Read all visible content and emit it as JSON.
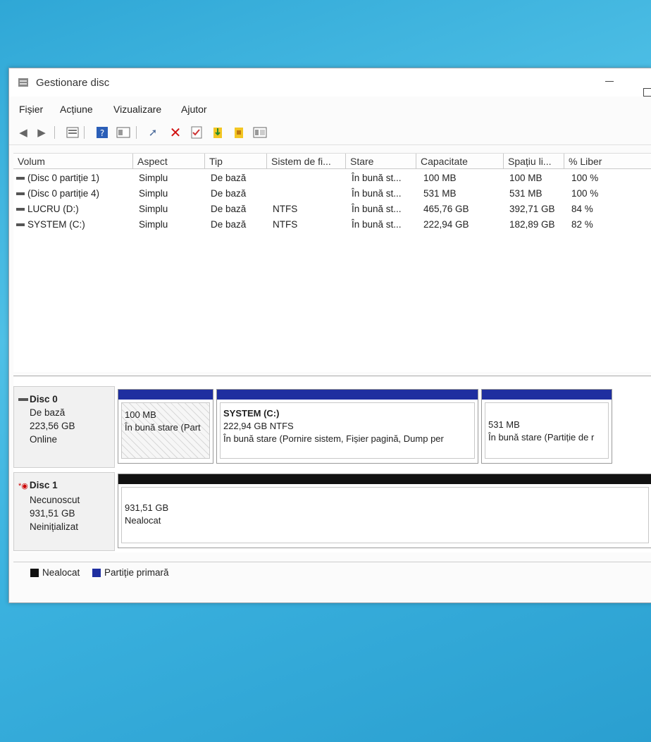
{
  "window": {
    "title": "Gestionare disc"
  },
  "menu": [
    "Fișier",
    "Acțiune",
    "Vizualizare",
    "Ajutor"
  ],
  "toolbar_icons": [
    "back-icon",
    "forward-icon",
    "properties-icon",
    "help-icon",
    "view-icon",
    "connect-icon",
    "delete-icon",
    "check-icon",
    "import-icon",
    "refresh-icon",
    "settings-icon"
  ],
  "columns": [
    "Volum",
    "Aspect",
    "Tip",
    "Sistem de fi...",
    "Stare",
    "Capacitate",
    "Spațiu li...",
    "% Liber"
  ],
  "volumes": [
    {
      "name": "(Disc 0 partiție 1)",
      "aspect": "Simplu",
      "tip": "De bază",
      "fs": "",
      "stare": "În bună st...",
      "capacitate": "100 MB",
      "liber": "100 MB",
      "pct": "100 %"
    },
    {
      "name": "(Disc 0 partiție 4)",
      "aspect": "Simplu",
      "tip": "De bază",
      "fs": "",
      "stare": "În bună st...",
      "capacitate": "531 MB",
      "liber": "531 MB",
      "pct": "100 %"
    },
    {
      "name": "LUCRU (D:)",
      "aspect": "Simplu",
      "tip": "De bază",
      "fs": "NTFS",
      "stare": "În bună st...",
      "capacitate": "465,76 GB",
      "liber": "392,71 GB",
      "pct": "84 %"
    },
    {
      "name": "SYSTEM (C:)",
      "aspect": "Simplu",
      "tip": "De bază",
      "fs": "NTFS",
      "stare": "În bună st...",
      "capacitate": "222,94 GB",
      "liber": "182,89 GB",
      "pct": "82 %"
    }
  ],
  "disk0": {
    "title": "Disc 0",
    "type": "De bază",
    "size": "223,56 GB",
    "status": "Online",
    "partitions": [
      {
        "title": "",
        "line1": "100 MB",
        "line2": "În bună stare (Part"
      },
      {
        "title": "SYSTEM  (C:)",
        "line1": "222,94 GB NTFS",
        "line2": "În bună stare (Pornire sistem, Fișier pagină, Dump per"
      },
      {
        "title": "",
        "line1": "531 MB",
        "line2": "În bună stare (Partiție de r"
      }
    ]
  },
  "disk1": {
    "title": "Disc 1",
    "type": "Necunoscut",
    "size": "931,51 GB",
    "status": "Neinițializat",
    "partition": {
      "line1": "931,51 GB",
      "line2": "Nealocat"
    }
  },
  "legend": [
    {
      "label": "Nealocat",
      "color": "#111111"
    },
    {
      "label": "Partiție primară",
      "color": "#1f2fa0"
    }
  ],
  "colors": {
    "primary_bar": "#1f2fa0",
    "unallocated_bar": "#111111"
  }
}
